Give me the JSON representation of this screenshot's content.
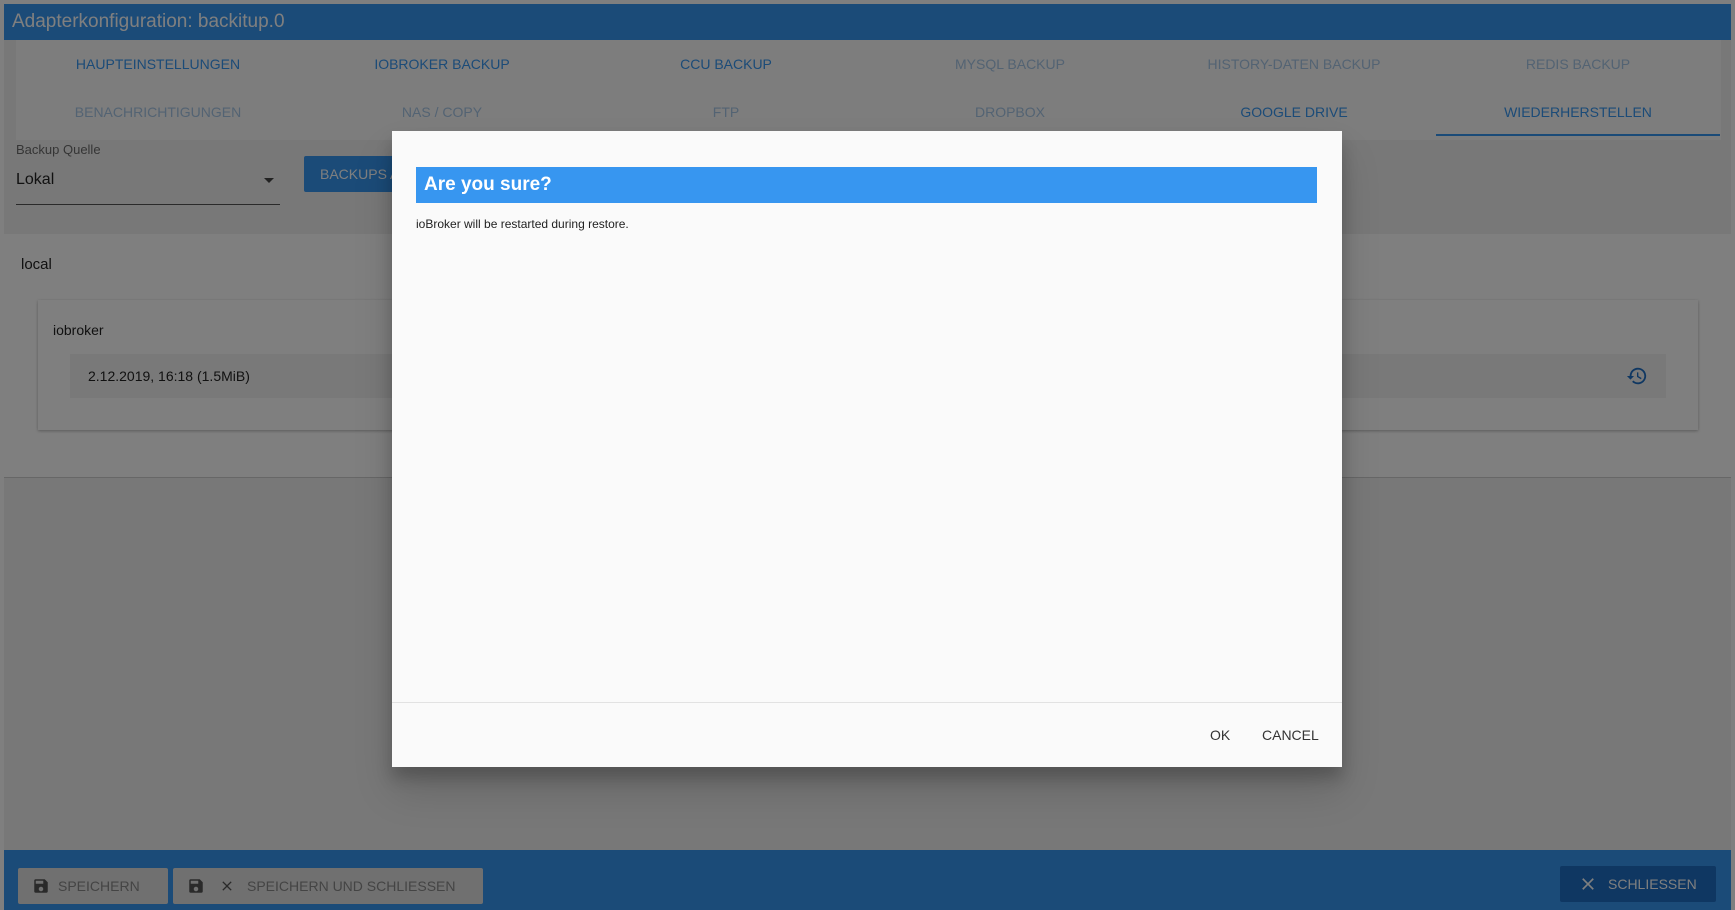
{
  "window": {
    "title": "Adapterkonfiguration: backitup.0"
  },
  "tabs": [
    {
      "label": "HAUPTEINSTELLUNGEN",
      "state": "normal"
    },
    {
      "label": "IOBROKER BACKUP",
      "state": "normal"
    },
    {
      "label": "CCU BACKUP",
      "state": "normal"
    },
    {
      "label": "MYSQL BACKUP",
      "state": "disabled"
    },
    {
      "label": "HISTORY-DATEN BACKUP",
      "state": "disabled"
    },
    {
      "label": "REDIS BACKUP",
      "state": "disabled"
    },
    {
      "label": "BENACHRICHTIGUNGEN",
      "state": "disabled"
    },
    {
      "label": "NAS / COPY",
      "state": "disabled"
    },
    {
      "label": "FTP",
      "state": "disabled"
    },
    {
      "label": "DROPBOX",
      "state": "disabled"
    },
    {
      "label": "GOOGLE DRIVE",
      "state": "normal"
    },
    {
      "label": "WIEDERHERSTELLEN",
      "state": "active"
    }
  ],
  "source": {
    "label": "Backup Quelle",
    "value": "Lokal"
  },
  "backups_button": {
    "label": "BACKUPS A"
  },
  "panel": {
    "local_label": "local",
    "group_title": "iobroker",
    "entry": "2.12.2019, 16:18 (1.5MiB)"
  },
  "bottom": {
    "save": "SPEICHERN",
    "save_close": "SPEICHERN UND SCHLIESSEN",
    "close": "SCHLIESSEN"
  },
  "dialog": {
    "title": "Are you sure?",
    "message": "ioBroker will be restarted during restore.",
    "ok": "OK",
    "cancel": "CANCEL"
  },
  "colors": {
    "primary": "#3796f0",
    "tab_disabled": "#a6c6e6"
  }
}
